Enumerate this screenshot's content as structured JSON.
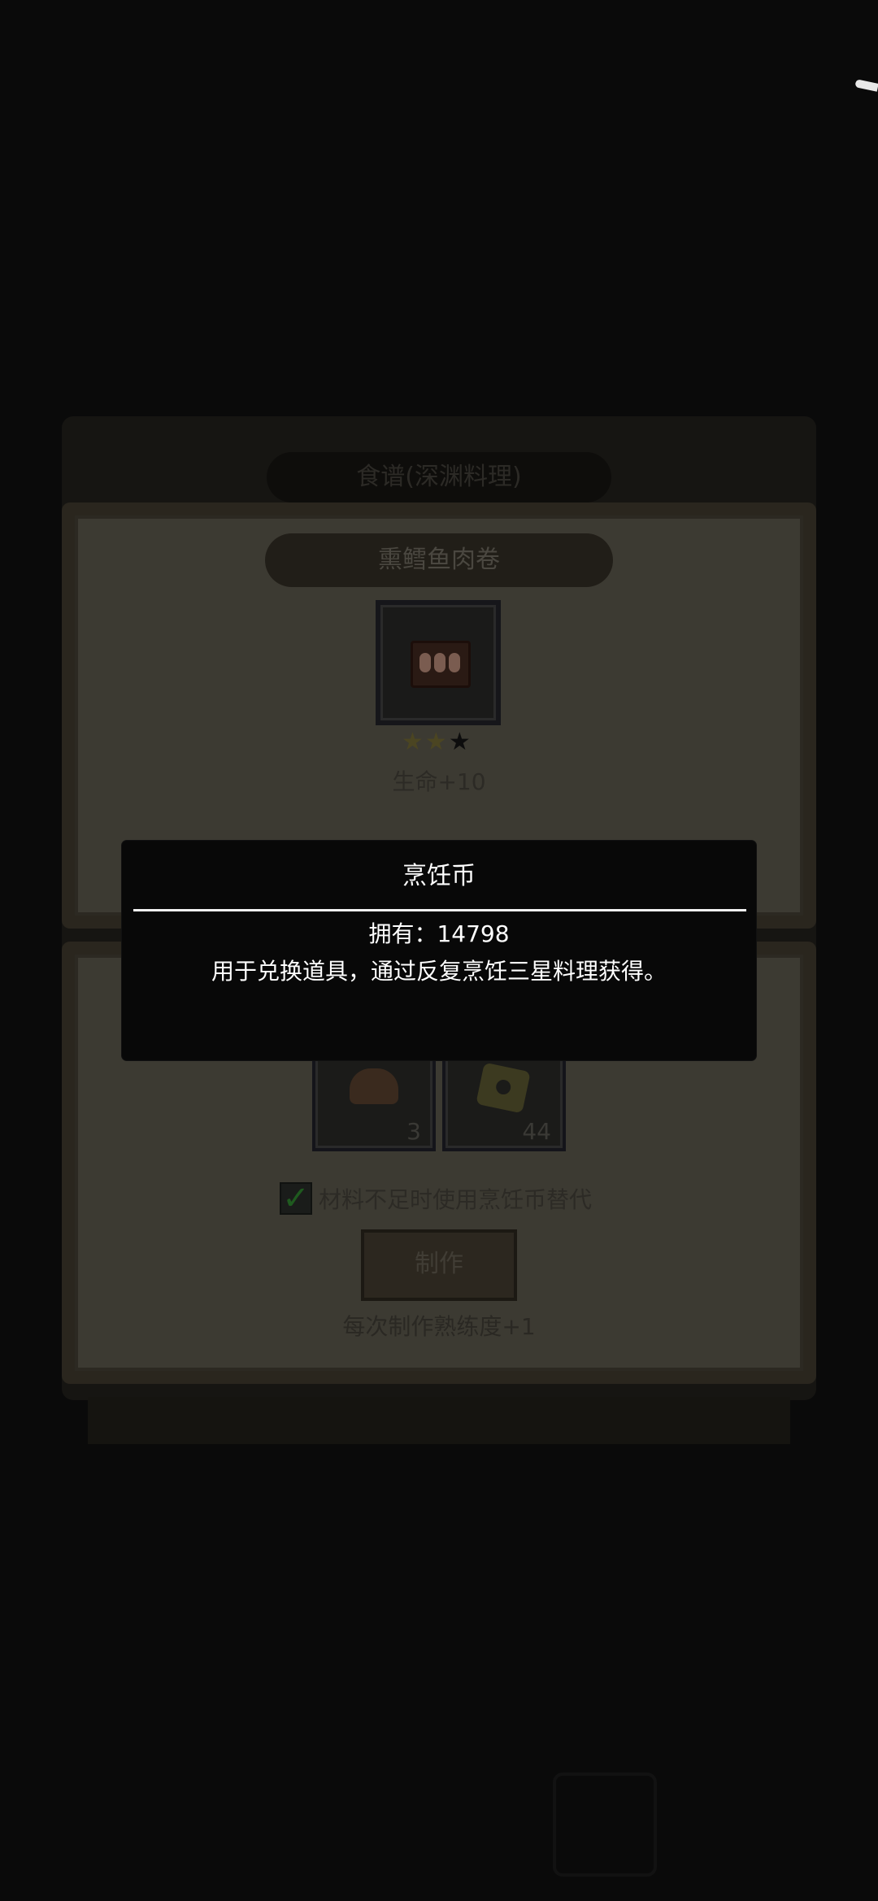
{
  "background": {
    "title_ghost": "",
    "panel_tab": "食谱(深渊料理)"
  },
  "recipe": {
    "name": "熏鳕鱼肉卷",
    "item_icon": "smoked-cod-roll-icon",
    "stars": {
      "filled": 2,
      "total": 3
    },
    "effect": "生命+10"
  },
  "materials": [
    {
      "icon": "bread-loaf-icon",
      "count": "3"
    },
    {
      "icon": "donut-icon",
      "count": "44"
    }
  ],
  "options": {
    "substitute_label": "材料不足时使用烹饪币替代",
    "substitute_checked": true
  },
  "actions": {
    "make_label": "制作",
    "proficiency_note": "每次制作熟练度+1"
  },
  "tooltip": {
    "title": "烹饪币",
    "owned": "拥有：14798",
    "description": "用于兑换道具，通过反复烹饪三星料理获得。"
  },
  "colors": {
    "overlay": "#0a0a0a",
    "dialog_bg": "#080808",
    "dialog_text": "#ffffff",
    "divider": "#f2f2f2",
    "check": "#1f5a1f"
  }
}
